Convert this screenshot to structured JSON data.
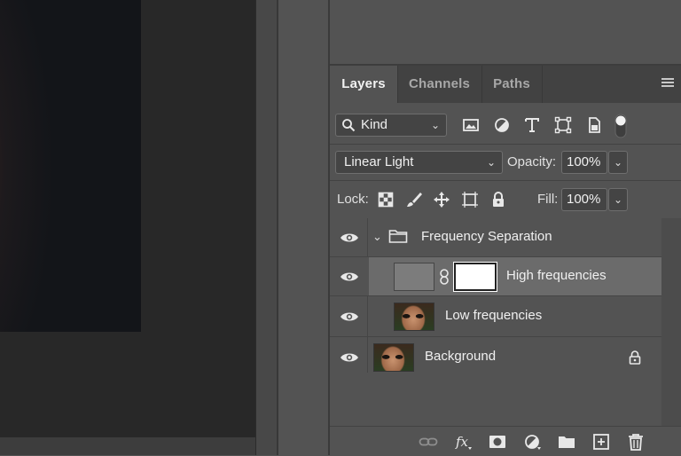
{
  "panel": {
    "tabs": [
      {
        "label": "Layers",
        "active": true
      },
      {
        "label": "Channels",
        "active": false
      },
      {
        "label": "Paths",
        "active": false
      }
    ]
  },
  "filter": {
    "kind_label": "Kind",
    "icons": [
      "image-filter-icon",
      "adjustment-filter-icon",
      "type-filter-icon",
      "shape-filter-icon",
      "smart-object-filter-icon",
      "filter-toggle"
    ]
  },
  "blend": {
    "mode": "Linear Light",
    "opacity_label": "Opacity:",
    "opacity_value": "100%"
  },
  "lock": {
    "label": "Lock:",
    "fill_label": "Fill:",
    "fill_value": "100%"
  },
  "layers": [
    {
      "name": "Frequency Separation",
      "type": "group",
      "visible": true,
      "expanded": true
    },
    {
      "name": "High frequencies",
      "type": "layer-with-mask",
      "visible": true,
      "selected": true
    },
    {
      "name": "Low frequencies",
      "type": "pixel",
      "visible": true
    },
    {
      "name": "Background",
      "type": "background",
      "visible": true,
      "locked": true
    }
  ],
  "bottom_bar": [
    "link-layers-icon",
    "fx-icon",
    "add-mask-icon",
    "adjustment-layer-icon",
    "new-group-icon",
    "new-layer-icon",
    "delete-icon"
  ],
  "colors": {
    "panel_bg": "#535353",
    "selected_row": "#6b6b6b",
    "canvas_bg": "#282828"
  }
}
